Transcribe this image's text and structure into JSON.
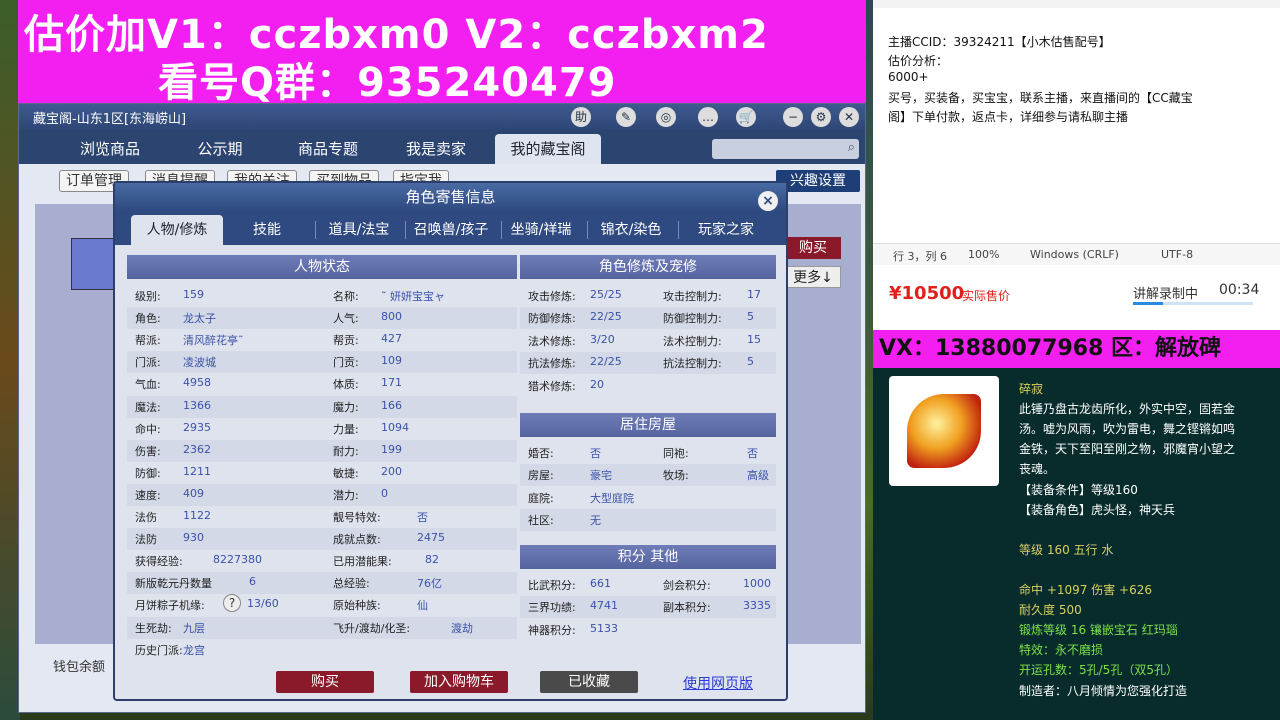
{
  "banner": {
    "line1": "估价加V1：cczbxm0     V2：cczbxm2",
    "line2": "看号Q群：935240479"
  },
  "window": {
    "title": "藏宝阁-山东1区[东海崂山]",
    "title_buttons": [
      "助",
      "✎",
      "◎",
      "…",
      "🛒",
      "−",
      "⚙",
      "✕"
    ]
  },
  "main_tabs": [
    "浏览商品",
    "公示期",
    "商品专题",
    "我是卖家",
    "我的藏宝阁"
  ],
  "sub_tabs": [
    "订单管理",
    "消息提醒",
    "我的关注",
    "买到物品",
    "指定我"
  ],
  "interest_settings": "兴趣设置",
  "side": {
    "buy": "购买",
    "more": "更多↓",
    "wallet": "钱包余额"
  },
  "dialog": {
    "title": "角色寄售信息",
    "close": "×",
    "tabs": [
      "人物/修炼",
      "技能",
      "道具/法宝",
      "召唤兽/孩子",
      "坐骑/祥瑞",
      "锦衣/染色",
      "玩家之家"
    ],
    "status_header": "人物状态",
    "left_col": [
      {
        "k": "级别:",
        "v": "159"
      },
      {
        "k": "角色:",
        "v": "龙太子"
      },
      {
        "k": "帮派:",
        "v": "清风醉花亭˜"
      },
      {
        "k": "门派:",
        "v": "凌波城"
      },
      {
        "k": "气血:",
        "v": "4958"
      },
      {
        "k": "魔法:",
        "v": "1366"
      },
      {
        "k": "命中:",
        "v": "2935"
      },
      {
        "k": "伤害:",
        "v": "2362"
      },
      {
        "k": "防御:",
        "v": "1211"
      },
      {
        "k": "速度:",
        "v": "409"
      },
      {
        "k": "法伤",
        "v": "1122"
      },
      {
        "k": "法防",
        "v": "930"
      },
      {
        "k": "获得经验:",
        "v": "8227380"
      },
      {
        "k": "新版乾元丹数量",
        "v": "6"
      },
      {
        "k": "月饼粽子机缘:",
        "v": "13/60"
      },
      {
        "k": "生死劫:",
        "v": "九层"
      },
      {
        "k": "历史门派:",
        "v": "龙宫"
      }
    ],
    "mid_col": [
      {
        "k": "名称:",
        "v": "˜ 妍妍宝宝ャ"
      },
      {
        "k": "人气:",
        "v": "800"
      },
      {
        "k": "帮贡:",
        "v": "427"
      },
      {
        "k": "门贡:",
        "v": "109"
      },
      {
        "k": "体质:",
        "v": "171"
      },
      {
        "k": "魔力:",
        "v": "166"
      },
      {
        "k": "力量:",
        "v": "1094"
      },
      {
        "k": "耐力:",
        "v": "199"
      },
      {
        "k": "敏捷:",
        "v": "200"
      },
      {
        "k": "潜力:",
        "v": "0"
      },
      {
        "k": "靓号特效:",
        "v": "否"
      },
      {
        "k": "成就点数:",
        "v": "2475"
      },
      {
        "k": "已用潜能果:",
        "v": "82"
      },
      {
        "k": "总经验:",
        "v": "76亿"
      },
      {
        "k": "原始种族:",
        "v": "仙"
      },
      {
        "k": "飞升/渡劫/化圣:",
        "v": "渡劫"
      }
    ],
    "cultivation_header": "角色修炼及宠修",
    "cultivation": [
      {
        "k": "攻击修炼:",
        "v": "25/25",
        "k2": "攻击控制力:",
        "v2": "17"
      },
      {
        "k": "防御修炼:",
        "v": "22/25",
        "k2": "防御控制力:",
        "v2": "5"
      },
      {
        "k": "法术修炼:",
        "v": "3/20",
        "k2": "法术控制力:",
        "v2": "15"
      },
      {
        "k": "抗法修炼:",
        "v": "22/25",
        "k2": "抗法控制力:",
        "v2": "5"
      },
      {
        "k": "猎术修炼:",
        "v": "20",
        "k2": "",
        "v2": ""
      }
    ],
    "house_header": "居住房屋",
    "house": [
      {
        "k": "婚否:",
        "v": "否",
        "k2": "同袍:",
        "v2": "否"
      },
      {
        "k": "房屋:",
        "v": "豪宅",
        "k2": "牧场:",
        "v2": "高级"
      },
      {
        "k": "庭院:",
        "v": "大型庭院",
        "k2": "",
        "v2": ""
      },
      {
        "k": "社区:",
        "v": "无",
        "k2": "",
        "v2": ""
      }
    ],
    "score_header": "积分 其他",
    "scores": [
      {
        "k": "比武积分:",
        "v": "661",
        "k2": "剑会积分:",
        "v2": "1000"
      },
      {
        "k": "三界功绩:",
        "v": "4741",
        "k2": "副本积分:",
        "v2": "3335"
      },
      {
        "k": "神器积分:",
        "v": "5133",
        "k2": "",
        "v2": ""
      }
    ],
    "buttons": {
      "buy": "购买",
      "cart": "加入购物车",
      "collected": "已收藏",
      "web": "使用网页版"
    }
  },
  "notepad": {
    "lines": [
      "主播CCID：39324211【小木估售配号】",
      "估价分析：",
      "6000+",
      "买号，买装备，买宝宝，联系主播，来直播间的【CC藏宝",
      "阁】下单付款，返点卡，详细参与请私聊主播"
    ],
    "status": {
      "pos": "行 3，列 6",
      "zoom": "100%",
      "eol": "Windows (CRLF)",
      "enc": "UTF-8"
    }
  },
  "stream": {
    "price": "¥10500",
    "price_label": "实际售价",
    "recording": "讲解录制中",
    "time": "00:34"
  },
  "vx": "VX：13880077968 区：解放碑",
  "item": {
    "name": "碎寂",
    "desc": [
      "此锤乃盘古龙齿所化，外实中空，固若金",
      "汤。嘘为风雨，吹为雷电，舞之铿锵如鸣",
      "金铁，天下至阳至刚之物，邪魔宵小望之",
      "丧魂。"
    ],
    "req": "【装备条件】等级160",
    "role": "【装备角色】虎头怪，神天兵",
    "level": "等级 160 五行 水",
    "stats": "命中 +1097 伤害 +626",
    "durability": "耐久度 500",
    "forge": "锻炼等级 16 镶嵌宝石 红玛瑙",
    "effect": "特效：永不磨损",
    "holes": "开运孔数：5孔/5孔（双5孔）",
    "maker": "制造者：八月倾情为您强化打造"
  },
  "colors": {
    "banner": "#f21ff0",
    "accent_red": "#8a1a2a",
    "value_blue": "#3a52a8",
    "item_green": "#7ce04a"
  }
}
